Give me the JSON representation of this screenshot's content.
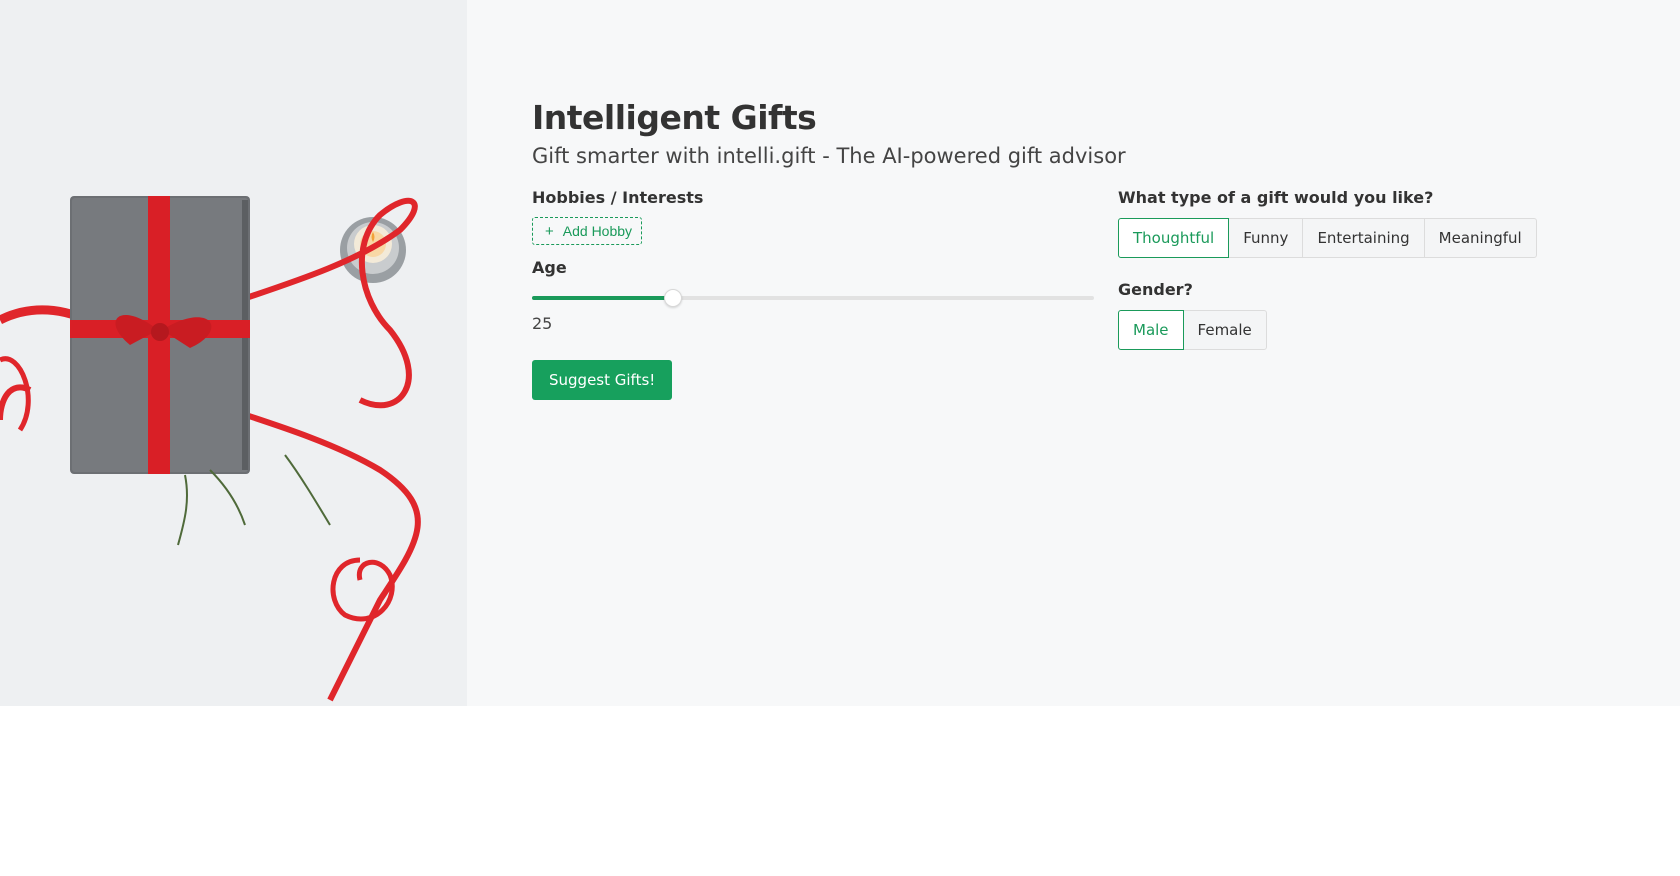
{
  "app": {
    "title": "Intelligent Gifts",
    "subtitle": "Gift smarter with intelli.gift - The AI-powered gift advisor"
  },
  "hobbies": {
    "label": "Hobbies / Interests",
    "add_button": "Add Hobby",
    "add_icon": "plus-icon"
  },
  "age": {
    "label": "Age",
    "value": "25",
    "slider_fraction": 0.25
  },
  "suggest_button": "Suggest Gifts!",
  "gift_type": {
    "label": "What type of a gift would you like?",
    "options": [
      "Thoughtful",
      "Funny",
      "Entertaining",
      "Meaningful"
    ],
    "selected": "Thoughtful"
  },
  "gender": {
    "label": "Gender?",
    "options": [
      "Male",
      "Female"
    ],
    "selected": "Male"
  },
  "colors": {
    "accent": "#1a9a5a",
    "button": "#17a05d",
    "ribbon": "#e0262b",
    "background": "#f7f8f9"
  }
}
